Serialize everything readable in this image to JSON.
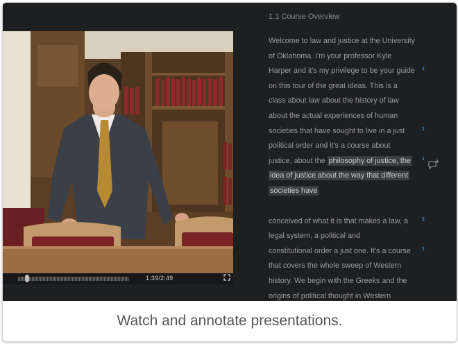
{
  "video": {
    "time": "1:39/2:49",
    "progress": 0.08,
    "fullscreen_icon": "fullscreen-icon"
  },
  "transcript": {
    "title": "1.1 Course Overview",
    "para1": {
      "lines": [
        {
          "text": " Welcome to law and justice at the University",
          "marker": ""
        },
        {
          "text": "of Oklahoma. I'm your professor Kyle",
          "marker": ""
        },
        {
          "text": "Harper  and it's my privilege to be your guide",
          "marker": "1"
        },
        {
          "text": "on this tour of the great ideas. This is a",
          "marker": ""
        },
        {
          "text": "class  about law about the history of law",
          "marker": ""
        },
        {
          "text": "about the actual experiences of human",
          "marker": ""
        },
        {
          "text": "societies that  have sought to live in a just",
          "marker": "1"
        },
        {
          "text": "political order and it's a course about",
          "marker": ""
        }
      ],
      "hl_line1_prefix": "justice, about the ",
      "hl_line1": "philosophy of justice, the",
      "hl_line1_marker": "1",
      "hl_line2": "idea of justice about the way that different",
      "hl_line3": "societies have"
    },
    "para2": {
      "lines": [
        {
          "text": " conceived of what it is that makes a law, a",
          "marker": "2"
        },
        {
          "text": "legal system, a political and",
          "marker": ""
        },
        {
          "text": "constitutional  order a just one. It's a course",
          "marker": "1"
        },
        {
          "text": "that covers the whole sweep of Western",
          "marker": ""
        },
        {
          "text": "history. We begin  with the Greeks and the",
          "marker": ""
        },
        {
          "text": "origins of political thought in Western",
          "marker": ""
        }
      ]
    },
    "add_note_icon": "add-note-icon"
  },
  "caption": "Watch and annotate presentations."
}
